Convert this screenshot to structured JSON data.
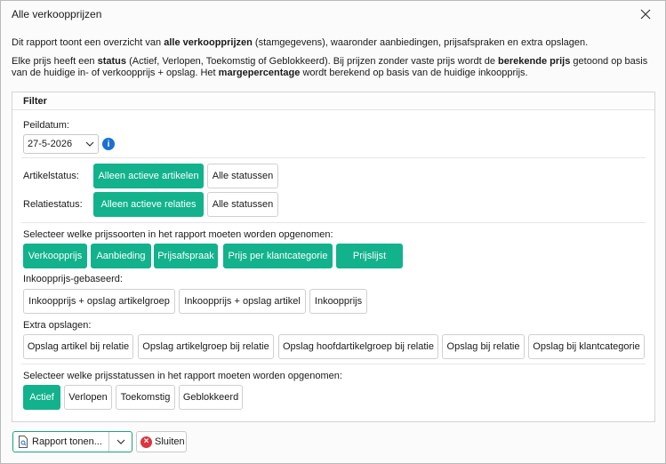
{
  "window": {
    "title": "Alle verkoopprijzen"
  },
  "intro": {
    "p1_a": "Dit rapport toont een overzicht van ",
    "p1_b": "alle verkoopprijzen",
    "p1_c": " (stamgegevens), waaronder aanbiedingen, prijsafspraken en extra opslagen.",
    "p2_a": "Elke prijs heeft een ",
    "p2_b": "status",
    "p2_c": " (Actief, Verlopen, Toekomstig of Geblokkeerd). Bij prijzen zonder vaste prijs wordt de ",
    "p2_d": "berekende prijs",
    "p2_e": " getoond op basis van de huidige in- of verkoopprijs + opslag. Het ",
    "p2_f": "margepercentage",
    "p2_g": " wordt berekend op basis van de huidige inkoopprijs."
  },
  "filter": {
    "header": "Filter",
    "peildatum_label": "Peildatum:",
    "peildatum_value": "27-5-2026",
    "info_glyph": "i",
    "artikelstatus_label": "Artikelstatus:",
    "artikelstatus_options": [
      "Alleen actieve artikelen",
      "Alle statussen"
    ],
    "artikelstatus_selected": "Alleen actieve artikelen",
    "relatiestatus_label": "Relatiestatus:",
    "relatiestatus_options": [
      "Alleen actieve relaties",
      "Alle statussen"
    ],
    "relatiestatus_selected": "Alleen actieve relaties",
    "prijssoorten_label": "Selecteer welke prijssoorten in het rapport moeten worden opgenomen:",
    "prijssoorten": [
      "Verkoopprijs",
      "Aanbieding",
      "Prijsafspraak",
      "Prijs per klantcategorie",
      "Prijslijst"
    ],
    "inkoop_label": "Inkoopprijs-gebaseerd:",
    "inkoop": [
      "Inkoopprijs + opslag artikelgroep",
      "Inkoopprijs + opslag artikel",
      "Inkoopprijs"
    ],
    "extra_label": "Extra opslagen:",
    "extra": [
      "Opslag artikel bij relatie",
      "Opslag artikelgroep bij relatie",
      "Opslag hoofdartikelgroep bij relatie",
      "Opslag bij relatie",
      "Opslag bij klantcategorie"
    ],
    "statussen_label": "Selecteer welke prijsstatussen in het rapport moeten worden opgenomen:",
    "statussen": [
      "Actief",
      "Verlopen",
      "Toekomstig",
      "Geblokkeerd"
    ]
  },
  "footer": {
    "report_button": "Rapport tonen...",
    "close_button": "Sluiten",
    "close_glyph": "×"
  },
  "colors": {
    "accent": "#12b28c",
    "info": "#1b6fd4",
    "danger": "#d9363e"
  }
}
